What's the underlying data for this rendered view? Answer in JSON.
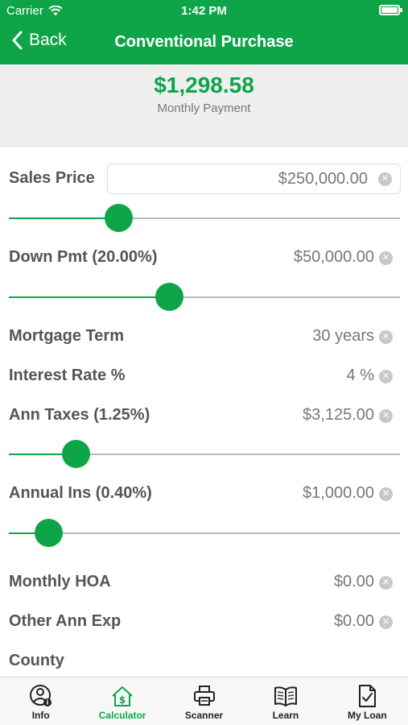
{
  "status_bar": {
    "carrier": "Carrier",
    "time": "1:42 PM"
  },
  "nav": {
    "back_label": "Back",
    "title": "Conventional Purchase"
  },
  "summary": {
    "amount": "$1,298.58",
    "label": "Monthly Payment"
  },
  "fields": {
    "sales_price": {
      "label": "Sales Price",
      "value": "$250,000.00",
      "slider_fraction": 0.28
    },
    "down_payment": {
      "label": "Down Pmt (20.00%)",
      "value": "$50,000.00",
      "slider_fraction": 0.41
    },
    "mortgage_term": {
      "label": "Mortgage Term",
      "value": "30 years"
    },
    "interest_rate": {
      "label": "Interest Rate %",
      "value": "4 %"
    },
    "ann_taxes": {
      "label": "Ann Taxes (1.25%)",
      "value": "$3,125.00",
      "slider_fraction": 0.17
    },
    "annual_ins": {
      "label": "Annual Ins (0.40%)",
      "value": "$1,000.00",
      "slider_fraction": 0.1
    },
    "monthly_hoa": {
      "label": "Monthly HOA",
      "value": "$0.00"
    },
    "other_ann_exp": {
      "label": "Other Ann Exp",
      "value": "$0.00"
    },
    "county": {
      "label": "County"
    }
  },
  "tabs": [
    {
      "label": "Info",
      "icon": "info-person-icon"
    },
    {
      "label": "Calculator",
      "icon": "house-dollar-icon",
      "active": true
    },
    {
      "label": "Scanner",
      "icon": "printer-icon"
    },
    {
      "label": "Learn",
      "icon": "open-book-icon"
    },
    {
      "label": "My Loan",
      "icon": "document-check-icon"
    }
  ],
  "colors": {
    "accent": "#0ea548",
    "summary_bg": "#efefef",
    "tabbar_bg": "#f7f7f7"
  }
}
